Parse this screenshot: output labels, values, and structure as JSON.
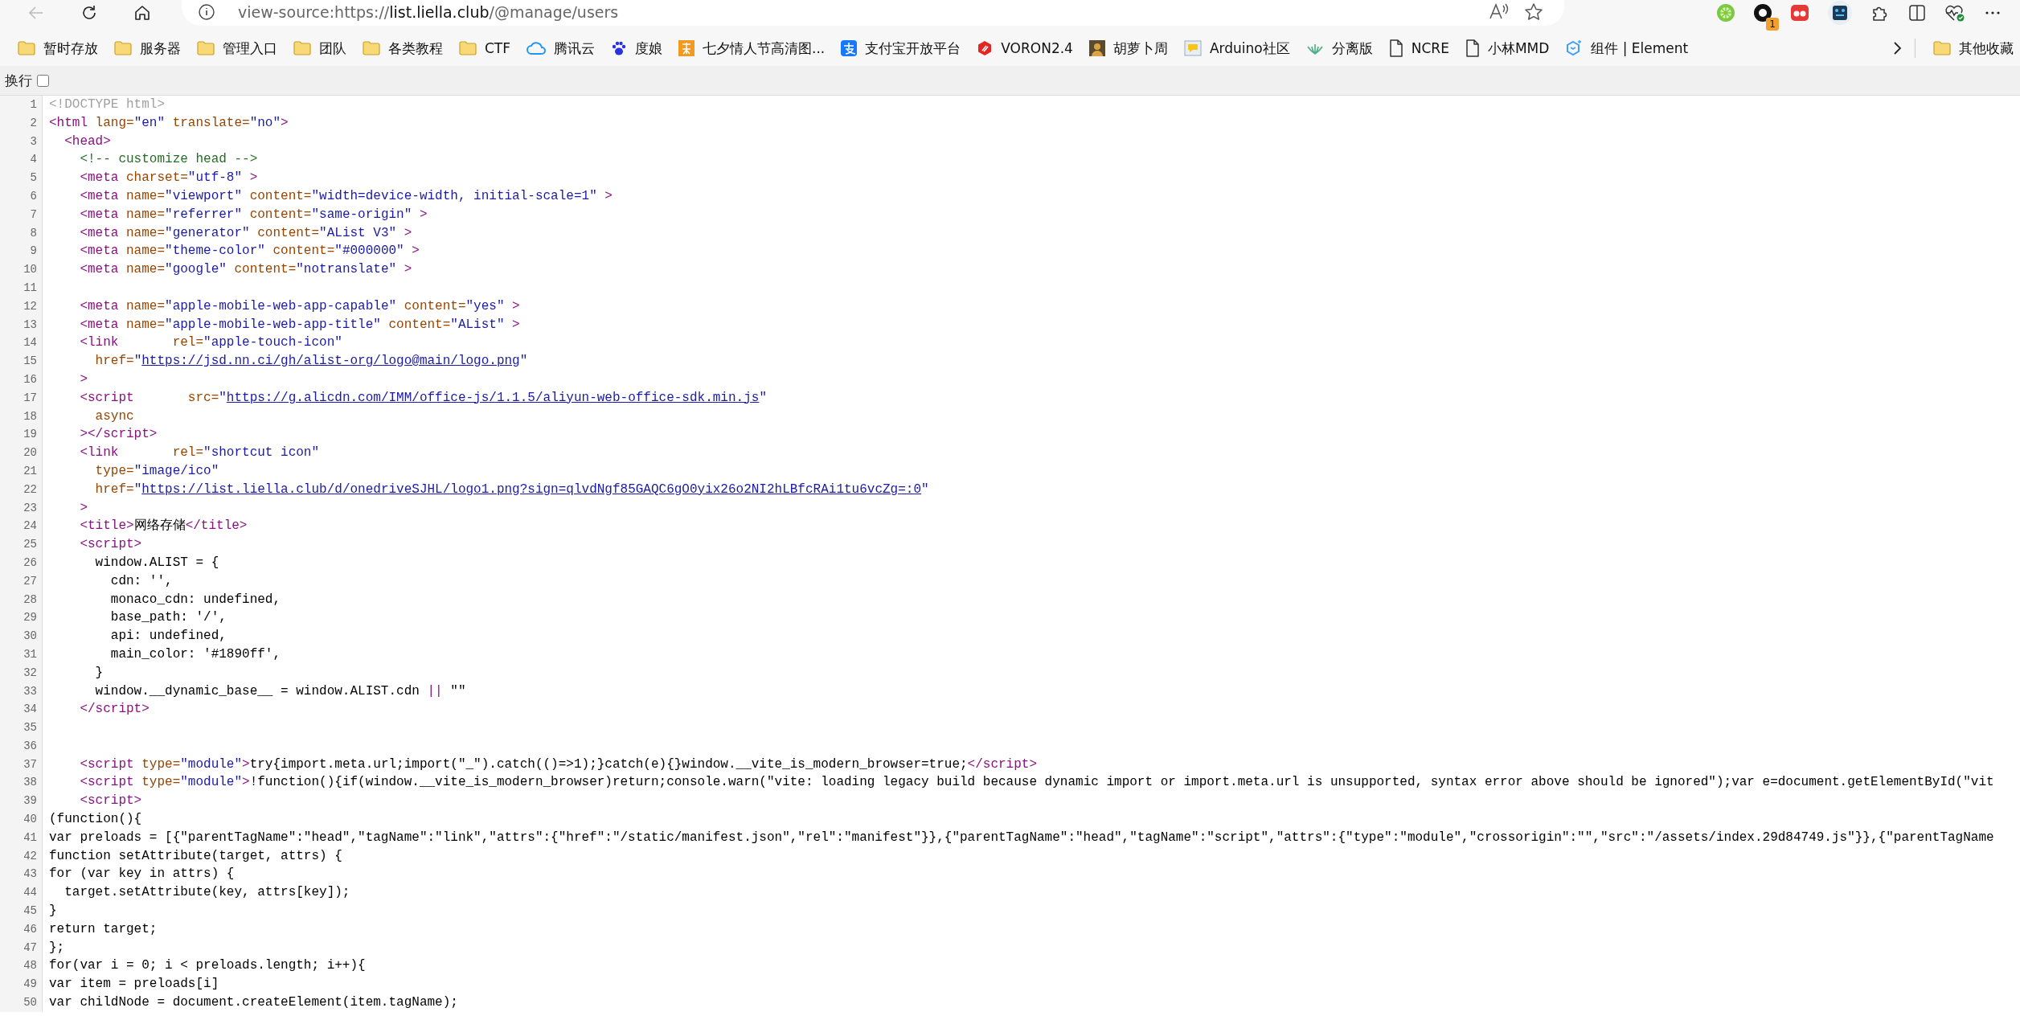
{
  "toolbar": {
    "back_button": {
      "disabled": true
    },
    "address": {
      "scheme": "view-source:https://",
      "host": "list.liella.club",
      "path": "/@manage/users"
    },
    "extension_badge": "1"
  },
  "bookmarks": [
    {
      "label": "暂时存放",
      "kind": "folder"
    },
    {
      "label": "服务器",
      "kind": "folder"
    },
    {
      "label": "管理入口",
      "kind": "folder"
    },
    {
      "label": "团队",
      "kind": "folder"
    },
    {
      "label": "各类教程",
      "kind": "folder"
    },
    {
      "label": "CTF",
      "kind": "folder"
    },
    {
      "label": "腾讯云",
      "kind": "cloud"
    },
    {
      "label": "度娘",
      "kind": "paw"
    },
    {
      "label": "七夕情人节高清图...",
      "kind": "image"
    },
    {
      "label": "支付宝开放平台",
      "kind": "pay"
    },
    {
      "label": "VORON2.4",
      "kind": "hexagon"
    },
    {
      "label": "胡萝卜周",
      "kind": "avatar"
    },
    {
      "label": "Arduino社区",
      "kind": "chat"
    },
    {
      "label": "分离版",
      "kind": "plant"
    },
    {
      "label": "NCRE",
      "kind": "page"
    },
    {
      "label": "小林MMD",
      "kind": "page"
    },
    {
      "label": "组件 | Element",
      "kind": "cube"
    }
  ],
  "other_bookmarks": "其他收藏",
  "wrap_toggle": {
    "label": "换行",
    "checked": false
  },
  "source_lines": [
    {
      "number": "1",
      "tokens": [
        {
          "kind": "doctype",
          "text": "<!DOCTYPE html>"
        }
      ]
    },
    {
      "number": "2",
      "tokens": [
        {
          "kind": "tag",
          "text": "<html "
        },
        {
          "kind": "attr",
          "text": "lang="
        },
        {
          "kind": "value",
          "text": "\"en\""
        },
        {
          "kind": "attr",
          "text": " translate="
        },
        {
          "kind": "value",
          "text": "\"no\""
        },
        {
          "kind": "tag",
          "text": ">"
        }
      ]
    },
    {
      "number": "3",
      "tokens": [
        {
          "kind": "tag",
          "text": "  <head>"
        }
      ]
    },
    {
      "number": "4",
      "tokens": [
        {
          "kind": "comment",
          "text": "    <!-- customize head -->"
        }
      ]
    },
    {
      "number": "5",
      "tokens": [
        {
          "kind": "tag",
          "text": "    <meta "
        },
        {
          "kind": "attr",
          "text": "charset="
        },
        {
          "kind": "value",
          "text": "\"utf-8\""
        },
        {
          "kind": "tag",
          "text": " >"
        }
      ]
    },
    {
      "number": "6",
      "tokens": [
        {
          "kind": "tag",
          "text": "    <meta "
        },
        {
          "kind": "attr",
          "text": "name="
        },
        {
          "kind": "value",
          "text": "\"viewport\""
        },
        {
          "kind": "attr",
          "text": " content="
        },
        {
          "kind": "value",
          "text": "\"width=device-width, initial-scale=1\""
        },
        {
          "kind": "tag",
          "text": " >"
        }
      ]
    },
    {
      "number": "7",
      "tokens": [
        {
          "kind": "tag",
          "text": "    <meta "
        },
        {
          "kind": "attr",
          "text": "name="
        },
        {
          "kind": "value",
          "text": "\"referrer\""
        },
        {
          "kind": "attr",
          "text": " content="
        },
        {
          "kind": "value",
          "text": "\"same-origin\""
        },
        {
          "kind": "tag",
          "text": " >"
        }
      ]
    },
    {
      "number": "8",
      "tokens": [
        {
          "kind": "tag",
          "text": "    <meta "
        },
        {
          "kind": "attr",
          "text": "name="
        },
        {
          "kind": "value",
          "text": "\"generator\""
        },
        {
          "kind": "attr",
          "text": " content="
        },
        {
          "kind": "value",
          "text": "\"AList V3\""
        },
        {
          "kind": "tag",
          "text": " >"
        }
      ]
    },
    {
      "number": "9",
      "tokens": [
        {
          "kind": "tag",
          "text": "    <meta "
        },
        {
          "kind": "attr",
          "text": "name="
        },
        {
          "kind": "value",
          "text": "\"theme-color\""
        },
        {
          "kind": "attr",
          "text": " content="
        },
        {
          "kind": "value",
          "text": "\"#000000\""
        },
        {
          "kind": "tag",
          "text": " >"
        }
      ]
    },
    {
      "number": "10",
      "tokens": [
        {
          "kind": "tag",
          "text": "    <meta "
        },
        {
          "kind": "attr",
          "text": "name="
        },
        {
          "kind": "value",
          "text": "\"google\""
        },
        {
          "kind": "attr",
          "text": " content="
        },
        {
          "kind": "value",
          "text": "\"notranslate\""
        },
        {
          "kind": "tag",
          "text": " >"
        }
      ]
    },
    {
      "number": "11"
    },
    {
      "number": "12",
      "tokens": [
        {
          "kind": "tag",
          "text": "    <meta "
        },
        {
          "kind": "attr",
          "text": "name="
        },
        {
          "kind": "value",
          "text": "\"apple-mobile-web-app-capable\""
        },
        {
          "kind": "attr",
          "text": " content="
        },
        {
          "kind": "value",
          "text": "\"yes\""
        },
        {
          "kind": "tag",
          "text": " >"
        }
      ]
    },
    {
      "number": "13",
      "tokens": [
        {
          "kind": "tag",
          "text": "    <meta "
        },
        {
          "kind": "attr",
          "text": "name="
        },
        {
          "kind": "value",
          "text": "\"apple-mobile-web-app-title\""
        },
        {
          "kind": "attr",
          "text": " content="
        },
        {
          "kind": "value",
          "text": "\"AList\""
        },
        {
          "kind": "tag",
          "text": " >"
        }
      ]
    },
    {
      "number": "14",
      "tokens": [
        {
          "kind": "tag",
          "text": "    <link"
        },
        {
          "kind": "attr",
          "text": "       rel="
        },
        {
          "kind": "value",
          "text": "\"apple-touch-icon\""
        }
      ]
    },
    {
      "number": "15",
      "tokens": [
        {
          "kind": "attr",
          "text": "      href="
        },
        {
          "kind": "value",
          "text": "\""
        },
        {
          "kind": "link",
          "text": "https://jsd.nn.ci/gh/alist-org/logo@main/logo.png"
        },
        {
          "kind": "value",
          "text": "\""
        }
      ]
    },
    {
      "number": "16",
      "tokens": [
        {
          "kind": "tag",
          "text": "    >"
        }
      ]
    },
    {
      "number": "17",
      "tokens": [
        {
          "kind": "tag",
          "text": "    <script"
        },
        {
          "kind": "attr",
          "text": "       src="
        },
        {
          "kind": "value",
          "text": "\""
        },
        {
          "kind": "link",
          "text": "https://g.alicdn.com/IMM/office-js/1.1.5/aliyun-web-office-sdk.min.js"
        },
        {
          "kind": "value",
          "text": "\""
        }
      ]
    },
    {
      "number": "18",
      "tokens": [
        {
          "kind": "attr",
          "text": "      async"
        }
      ]
    },
    {
      "number": "19",
      "tokens": [
        {
          "kind": "tag",
          "text": "    ></script>"
        }
      ]
    },
    {
      "number": "20",
      "tokens": [
        {
          "kind": "tag",
          "text": "    <link"
        },
        {
          "kind": "attr",
          "text": "       rel="
        },
        {
          "kind": "value",
          "text": "\"shortcut icon\""
        }
      ]
    },
    {
      "number": "21",
      "tokens": [
        {
          "kind": "attr",
          "text": "      type="
        },
        {
          "kind": "value",
          "text": "\"image/ico\""
        }
      ]
    },
    {
      "number": "22",
      "tokens": [
        {
          "kind": "attr",
          "text": "      href="
        },
        {
          "kind": "value",
          "text": "\""
        },
        {
          "kind": "link",
          "text": "https://list.liella.club/d/onedriveSJHL/logo1.png?sign=qlvdNgf85GAQC6gO0yix26o2NI2hLBfcRAi1tu6vcZg=:0"
        },
        {
          "kind": "value",
          "text": "\""
        }
      ]
    },
    {
      "number": "23",
      "tokens": [
        {
          "kind": "tag",
          "text": "    >"
        }
      ]
    },
    {
      "number": "24",
      "tokens": [
        {
          "kind": "tag",
          "text": "    <title>"
        },
        {
          "kind": "text",
          "text": "网络存储"
        },
        {
          "kind": "tag",
          "text": "</title>"
        }
      ]
    },
    {
      "number": "25",
      "tokens": [
        {
          "kind": "tag",
          "text": "    <script>"
        }
      ]
    },
    {
      "number": "26",
      "tokens": [
        {
          "kind": "text",
          "text": "      window.ALIST = {"
        }
      ]
    },
    {
      "number": "27",
      "tokens": [
        {
          "kind": "text",
          "text": "        cdn: '',"
        }
      ]
    },
    {
      "number": "28",
      "tokens": [
        {
          "kind": "text",
          "text": "        monaco_cdn: undefined,"
        }
      ]
    },
    {
      "number": "29",
      "tokens": [
        {
          "kind": "text",
          "text": "        base_path: '/',"
        }
      ]
    },
    {
      "number": "30",
      "tokens": [
        {
          "kind": "text",
          "text": "        api: undefined,"
        }
      ]
    },
    {
      "number": "31",
      "tokens": [
        {
          "kind": "text",
          "text": "        main_color: '#1890ff',"
        }
      ]
    },
    {
      "number": "32",
      "tokens": [
        {
          "kind": "text",
          "text": "      }"
        }
      ]
    },
    {
      "number": "33",
      "tokens": [
        {
          "kind": "text",
          "text": "      window.__dynamic_base__ = window.ALIST.cdn "
        },
        {
          "kind": "tag",
          "text": "||"
        },
        {
          "kind": "text",
          "text": " \"\""
        }
      ]
    },
    {
      "number": "34",
      "tokens": [
        {
          "kind": "tag",
          "text": "    </script>"
        }
      ]
    },
    {
      "number": "35"
    },
    {
      "number": "36"
    },
    {
      "number": "37",
      "tokens": [
        {
          "kind": "tag",
          "text": "    <script "
        },
        {
          "kind": "attr",
          "text": "type="
        },
        {
          "kind": "value",
          "text": "\"module\""
        },
        {
          "kind": "tag",
          "text": ">"
        },
        {
          "kind": "text",
          "text": "try{import.meta.url;import(\"_\").catch(()=>1);}catch(e){}window.__vite_is_modern_browser=true;"
        },
        {
          "kind": "tag",
          "text": "</script>"
        }
      ]
    },
    {
      "number": "38",
      "tokens": [
        {
          "kind": "tag",
          "text": "    <script "
        },
        {
          "kind": "attr",
          "text": "type="
        },
        {
          "kind": "value",
          "text": "\"module\""
        },
        {
          "kind": "tag",
          "text": ">"
        },
        {
          "kind": "text",
          "text": "!function(){if(window.__vite_is_modern_browser)return;console.warn(\"vite: loading legacy build because dynamic import or import.meta.url is unsupported, syntax error above should be ignored\");var e=document.getElementById(\"vit"
        }
      ]
    },
    {
      "number": "39",
      "tokens": [
        {
          "kind": "tag",
          "text": "    <script>"
        }
      ]
    },
    {
      "number": "40",
      "tokens": [
        {
          "kind": "text",
          "text": "(function(){"
        }
      ]
    },
    {
      "number": "41",
      "tokens": [
        {
          "kind": "text",
          "text": "var preloads = [{\"parentTagName\":\"head\",\"tagName\":\"link\",\"attrs\":{\"href\":\"/static/manifest.json\",\"rel\":\"manifest\"}},{\"parentTagName\":\"head\",\"tagName\":\"script\",\"attrs\":{\"type\":\"module\",\"crossorigin\":\"\",\"src\":\"/assets/index.29d84749.js\"}},{\"parentTagName"
        }
      ]
    },
    {
      "number": "42",
      "tokens": [
        {
          "kind": "text",
          "text": "function setAttribute(target, attrs) {"
        }
      ]
    },
    {
      "number": "43",
      "tokens": [
        {
          "kind": "text",
          "text": "for (var key in attrs) {"
        }
      ]
    },
    {
      "number": "44",
      "tokens": [
        {
          "kind": "text",
          "text": "  target.setAttribute(key, attrs[key]);"
        }
      ]
    },
    {
      "number": "45",
      "tokens": [
        {
          "kind": "text",
          "text": "}"
        }
      ]
    },
    {
      "number": "46",
      "tokens": [
        {
          "kind": "text",
          "text": "return target;"
        }
      ]
    },
    {
      "number": "47",
      "tokens": [
        {
          "kind": "text",
          "text": "};"
        }
      ]
    },
    {
      "number": "48",
      "tokens": [
        {
          "kind": "text",
          "text": "for(var i = 0; i < preloads.length; i++){"
        }
      ]
    },
    {
      "number": "49",
      "tokens": [
        {
          "kind": "text",
          "text": "var item = preloads[i]"
        }
      ]
    },
    {
      "number": "50",
      "tokens": [
        {
          "kind": "text",
          "text": "var childNode = document.createElement(item.tagName);"
        }
      ]
    }
  ]
}
